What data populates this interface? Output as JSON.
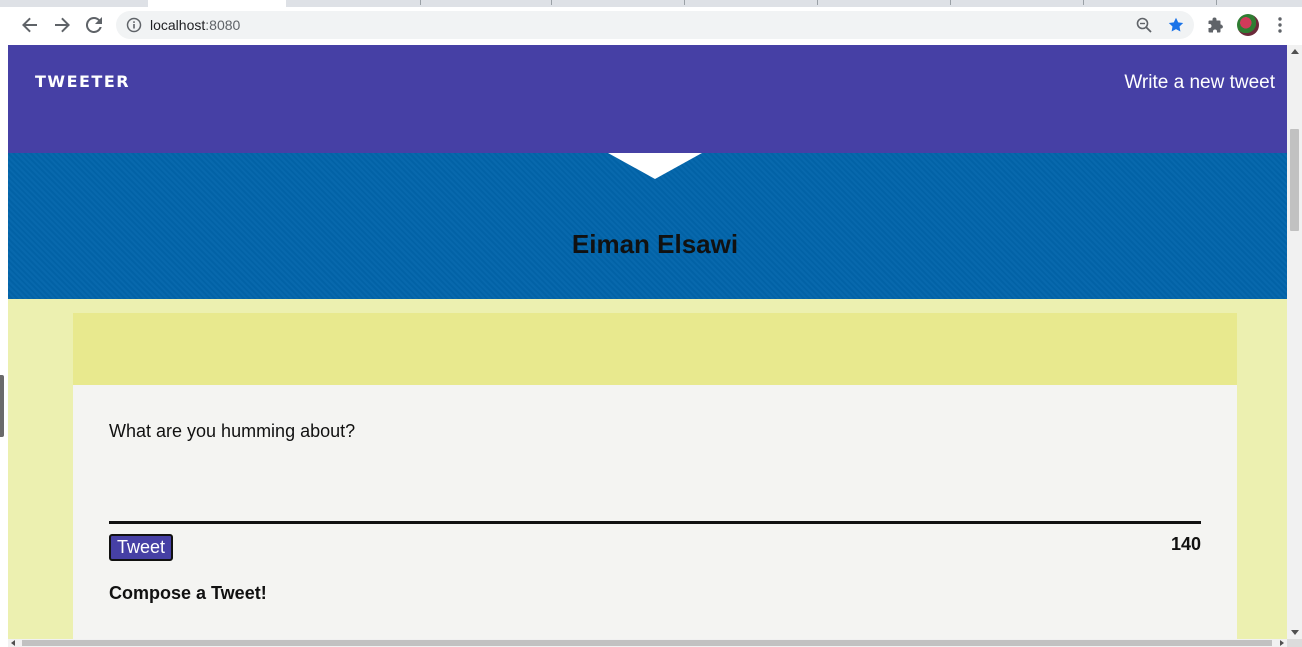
{
  "browser": {
    "url_host": "localhost",
    "url_port": ":8080",
    "icons": {
      "back": "arrow-left-icon",
      "forward": "arrow-right-icon",
      "reload": "reload-icon",
      "site_info": "info-icon",
      "zoom": "zoom-out-icon",
      "bookmark": "star-icon",
      "extensions": "puzzle-icon",
      "menu": "kebab-menu-icon"
    },
    "bookmark_color": "#1a73e8"
  },
  "nav": {
    "brand": "TWEETER",
    "write_link": "Write a new tweet",
    "background": "#4640a5"
  },
  "profile": {
    "name": "Eiman Elsawi",
    "background": "#0265ab"
  },
  "compose": {
    "prompt": "What are you humming about?",
    "tweet_button": "Tweet",
    "counter": "140",
    "heading": "Compose a Tweet!"
  }
}
